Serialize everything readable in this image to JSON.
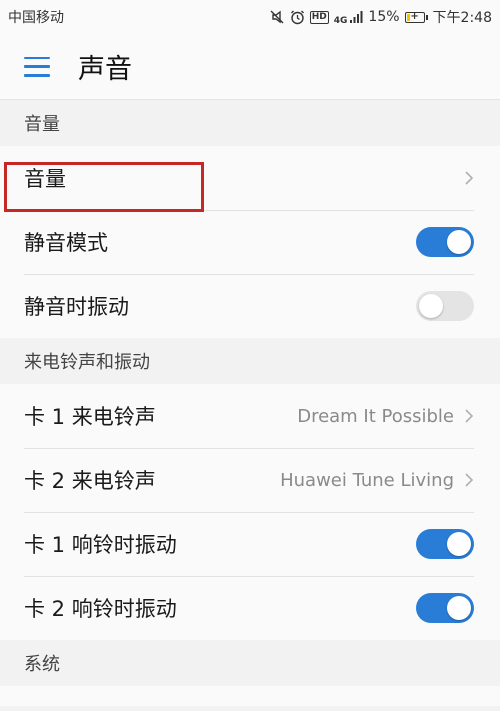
{
  "status_bar": {
    "carrier": "中国移动",
    "hd_label": "HD",
    "network": "4G",
    "battery": "15%",
    "time": "下午2:48"
  },
  "toolbar": {
    "title": "声音"
  },
  "sections": [
    {
      "header": "音量",
      "rows": [
        {
          "label": "音量",
          "type": "nav"
        },
        {
          "label": "静音模式",
          "type": "toggle",
          "on": true
        },
        {
          "label": "静音时振动",
          "type": "toggle",
          "on": false
        }
      ]
    },
    {
      "header": "来电铃声和振动",
      "rows": [
        {
          "label": "卡 1 来电铃声",
          "type": "nav",
          "value": "Dream It Possible"
        },
        {
          "label": "卡 2 来电铃声",
          "type": "nav",
          "value": "Huawei Tune Living"
        },
        {
          "label": "卡 1 响铃时振动",
          "type": "toggle",
          "on": true
        },
        {
          "label": "卡 2 响铃时振动",
          "type": "toggle",
          "on": true
        }
      ]
    },
    {
      "header": "系统"
    }
  ],
  "colors": {
    "accent": "#2a7dd6",
    "highlight": "#c62828",
    "toggle_off": "#e4e4e4"
  }
}
